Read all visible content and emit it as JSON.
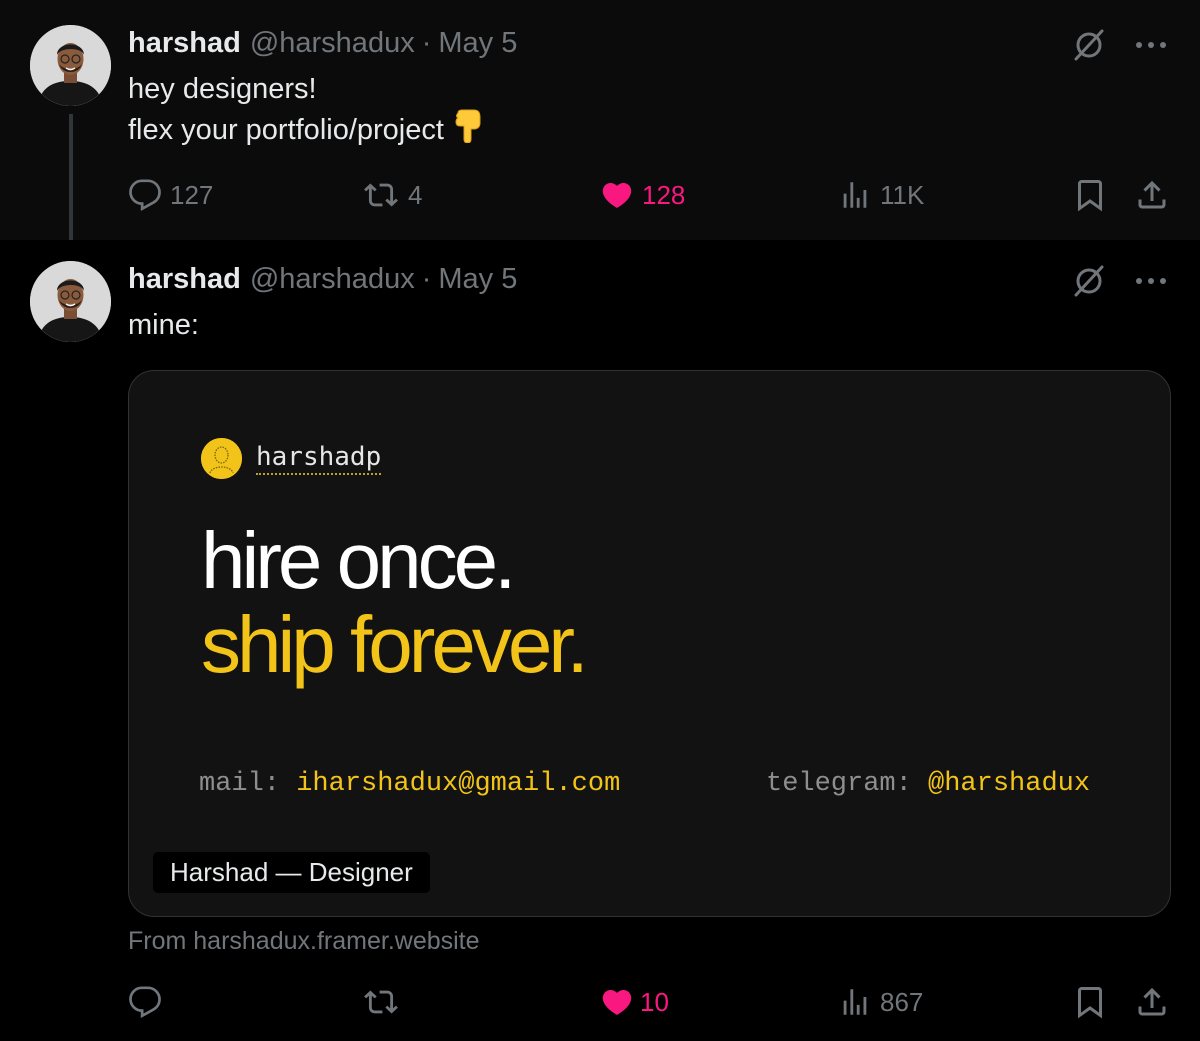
{
  "colors": {
    "background": "#000000",
    "accent_like": "#f91880",
    "muted": "#71767b",
    "card_highlight": "#f2c318"
  },
  "tweet1": {
    "author_name": "harshad",
    "handle": "@harshadux",
    "separator": "·",
    "date": "May 5",
    "text_line1": "hey designers!",
    "text_line2": "flex your portfolio/project",
    "emoji": "backhand-index-pointing-down",
    "actions": {
      "reply_count": "127",
      "retweet_count": "4",
      "like_count": "128",
      "views_count": "11K"
    }
  },
  "tweet2": {
    "author_name": "harshad",
    "handle": "@harshadux",
    "separator": "·",
    "date": "May 5",
    "text": "mine:",
    "card": {
      "brand_name": "harshadp",
      "headline_line1": "hire once.",
      "headline_line2": "ship forever.",
      "mail_label": "mail:",
      "mail_value": "iharshadux@gmail.com",
      "telegram_label": "telegram:",
      "telegram_value": "@harshadux",
      "tag": "Harshad — Designer"
    },
    "source": "From harshadux.framer.website",
    "actions": {
      "like_count": "10",
      "views_count": "867"
    }
  },
  "icons": [
    "reply-icon",
    "retweet-icon",
    "heart-icon",
    "views-icon",
    "bookmark-icon",
    "share-icon",
    "grok-icon",
    "more-icon"
  ]
}
